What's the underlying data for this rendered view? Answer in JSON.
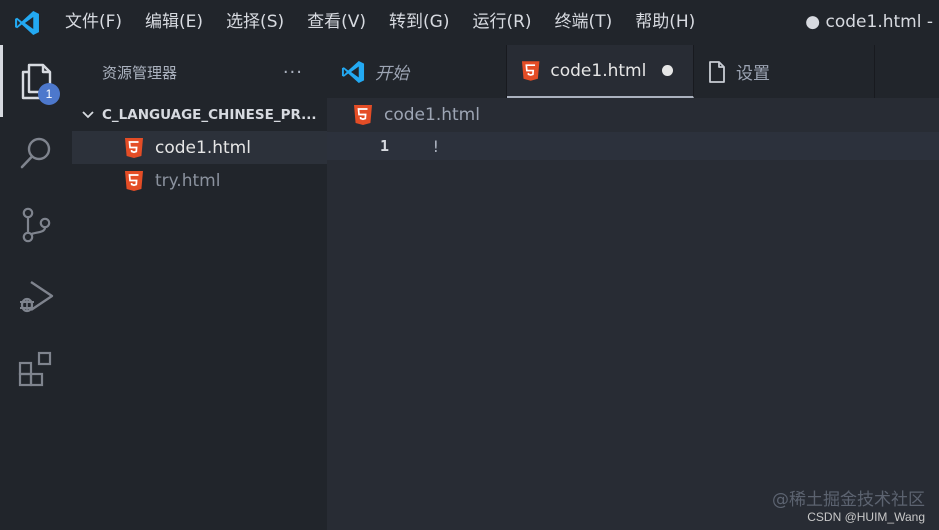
{
  "menu": {
    "items": [
      "文件(F)",
      "编辑(E)",
      "选择(S)",
      "查看(V)",
      "转到(G)",
      "运行(R)",
      "终端(T)",
      "帮助(H)"
    ]
  },
  "window": {
    "title": "● code1.html -"
  },
  "activity_bar": {
    "explorer_badge": "1"
  },
  "sidebar": {
    "title": "资源管理器",
    "more_label": "···",
    "folder": "C_LANGUAGE_CHINESE_PR...",
    "files": [
      "code1.html",
      "try.html"
    ]
  },
  "tabs": [
    {
      "label": "开始",
      "icon": "vscode-logo-icon"
    },
    {
      "label": "code1.html",
      "icon": "html5-icon",
      "active": true,
      "dirty": true
    },
    {
      "label": "设置",
      "icon": "file-icon"
    }
  ],
  "breadcrumb": {
    "file": "code1.html"
  },
  "editor": {
    "lines": [
      {
        "number": "1",
        "text": "!"
      }
    ]
  },
  "watermark": {
    "line1": "@稀土掘金技术社区",
    "line2": "CSDN @HUIM_Wang"
  },
  "colors": {
    "background": "#21252b",
    "editor_background": "#282c34",
    "accent_blue": "#4d78cc",
    "html_icon": "#e44d26",
    "vscode_blue": "#23a9f2"
  }
}
